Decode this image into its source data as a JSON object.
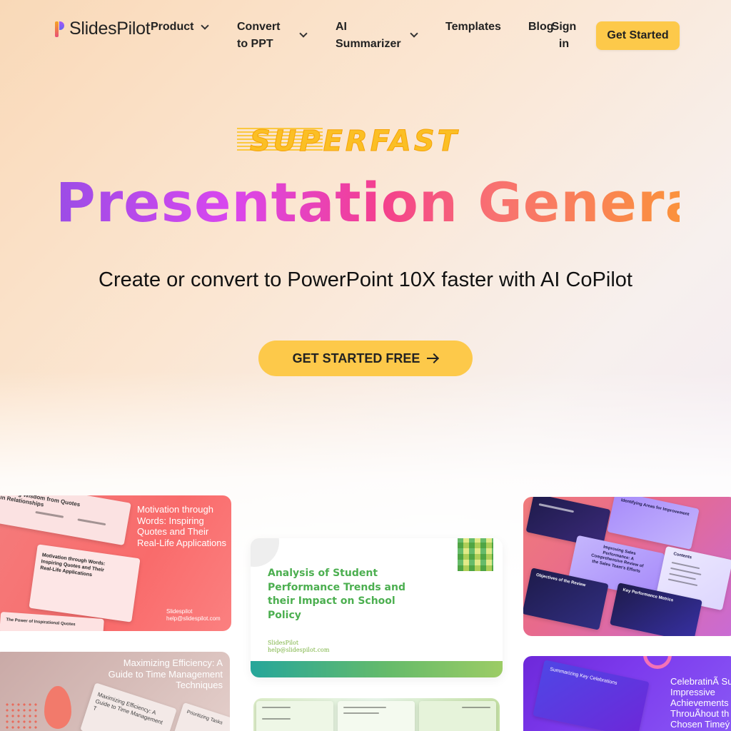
{
  "brand": {
    "name": "SlidesPilot"
  },
  "nav": {
    "items": [
      {
        "label": "Product"
      },
      {
        "label": "Convert to PPT"
      },
      {
        "label": "AI Summarizer"
      },
      {
        "label": "Templates"
      },
      {
        "label": "Blog"
      },
      {
        "label": "Sign in"
      }
    ],
    "cta_label": "Get Started"
  },
  "hero": {
    "eyebrow": "SUPERFAST",
    "headline": "Presentation Generator",
    "subheadline": "Create or convert to PowerPoint 10X faster with AI CoPilot",
    "cta_label": "GET STARTED FREE"
  },
  "slides": {
    "motivation": {
      "title": "Motivation through Words: Inspiring Quotes and Their Real-Life Applications",
      "mini_title": "Motivation through Words: Inspiring Quotes and Their Real-Life Applications",
      "mini_top": "Finding Wisdom from Quotes in Relationships",
      "mini_bottom": "The Power of Inspirational Quotes",
      "footer_name": "Slidespilot",
      "footer_email": "help@slidespilot.com"
    },
    "students": {
      "title": "Analysis of Student Performance Trends and their Impact on School Policy",
      "footer_name": "SlidesPilot",
      "footer_email": "help@slidespilot.com"
    },
    "sales": {
      "mini_center": "Improving Sales Performance: A Comprehensive Review of the Sales Team's Efforts",
      "mini_top": "Identifying Areas for Improvement",
      "mini_left": "Objectives of the Review",
      "mini_right": "Key Performance Metrics",
      "mini_contents": "Contents"
    },
    "efficiency": {
      "title": "Maximizing Efficiency: A Guide to Time Management Techniques",
      "mini_title": "Maximizing Efficiency: A Guide to Time Management T",
      "mini_right": "Prioritizing Tasks"
    },
    "celebrating": {
      "title": "CelebratinÃ Su Impressive Achievements ThrouÃhout th Chosen Timeý",
      "mini_title": "Summarizing Key Celebrations"
    }
  },
  "colors": {
    "accent": "#fdc94a",
    "headline_gradient": [
      "#9b4de6",
      "#d946ef",
      "#f43f8e",
      "#f87171",
      "#fb923c"
    ]
  }
}
